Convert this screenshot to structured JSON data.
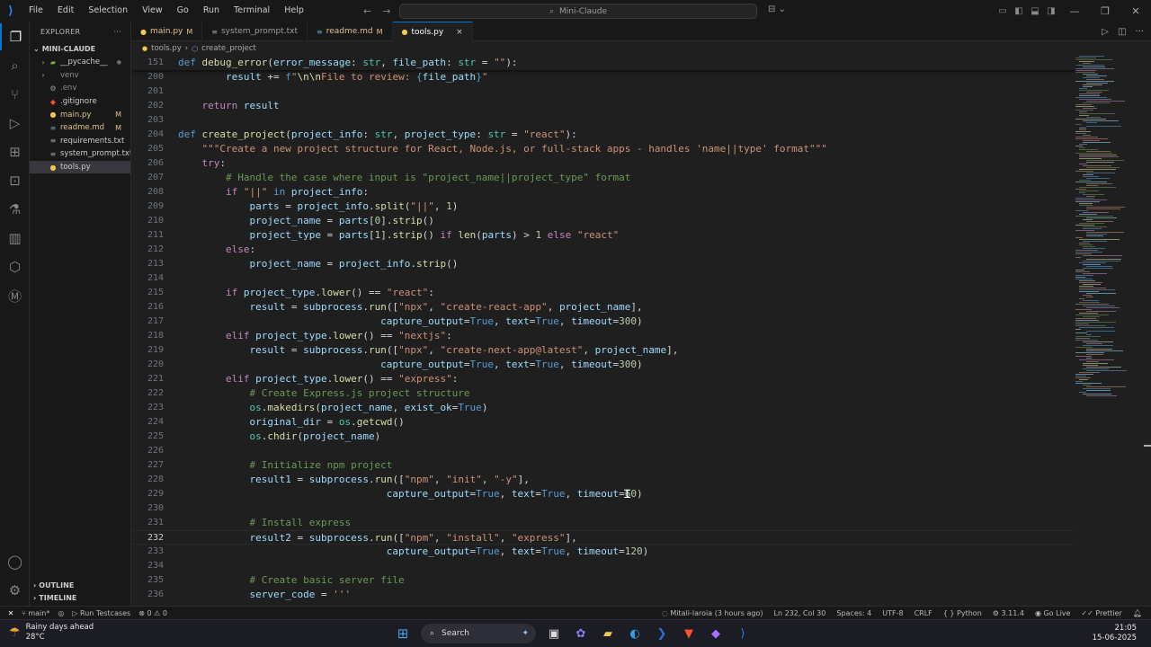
{
  "titlebar": {
    "menu": [
      "File",
      "Edit",
      "Selection",
      "View",
      "Go",
      "Run",
      "Terminal",
      "Help"
    ],
    "search_text": "Mini-Claude"
  },
  "explorer": {
    "header": "EXPLORER",
    "more": "···",
    "root": "MINI-CLAUDE",
    "items": [
      {
        "name": "__pycache__",
        "badge": "●",
        "type": "folder"
      },
      {
        "name": "venv",
        "badge": "",
        "type": "folder"
      },
      {
        "name": ".env",
        "badge": "",
        "type": "gear"
      },
      {
        "name": ".gitignore",
        "badge": "",
        "type": "git"
      },
      {
        "name": "main.py",
        "badge": "M",
        "type": "py"
      },
      {
        "name": "readme.md",
        "badge": "M",
        "type": "md"
      },
      {
        "name": "requirements.txt",
        "badge": "",
        "type": "txt"
      },
      {
        "name": "system_prompt.txt",
        "badge": "",
        "type": "txt"
      },
      {
        "name": "tools.py",
        "badge": "",
        "type": "py"
      }
    ],
    "outline": "OUTLINE",
    "timeline": "TIMELINE"
  },
  "tabs": [
    {
      "label": "main.py",
      "status": "M"
    },
    {
      "label": "system_prompt.txt",
      "status": ""
    },
    {
      "label": "readme.md",
      "status": "M"
    },
    {
      "label": "tools.py",
      "status": "×"
    }
  ],
  "breadcrumb": {
    "file": "tools.py",
    "sep": "›",
    "symbol": "create_project"
  },
  "editor": {
    "lines": [
      {
        "n": "151",
        "html": "<span class=\"k\">def</span> <span class=\"f\">debug_error</span><span class=\"o\">(</span><span class=\"p\">error_message</span><span class=\"o\">: </span><span class=\"t\">str</span><span class=\"o\">, </span><span class=\"p\">file_path</span><span class=\"o\">: </span><span class=\"t\">str</span><span class=\"o\"> = </span><span class=\"s\">\"\"</span><span class=\"o\">):</span>"
      },
      {
        "n": "200",
        "html": "        <span class=\"p\">result</span><span class=\"o\"> += </span><span class=\"k\">f</span><span class=\"s\">\"</span><span class=\"f\">\\n\\n</span><span class=\"s\">File to review: </span><span class=\"k\">{</span><span class=\"p\">file_path</span><span class=\"k\">}</span><span class=\"s\">\"</span>"
      },
      {
        "n": "201",
        "html": ""
      },
      {
        "n": "202",
        "html": "    <span class=\"kc\">return</span> <span class=\"p\">result</span>"
      },
      {
        "n": "203",
        "html": ""
      },
      {
        "n": "204",
        "html": "<span class=\"k\">def</span> <span class=\"f\">create_project</span><span class=\"o\">(</span><span class=\"p\">project_info</span><span class=\"o\">: </span><span class=\"t\">str</span><span class=\"o\">, </span><span class=\"p\">project_type</span><span class=\"o\">: </span><span class=\"t\">str</span><span class=\"o\"> = </span><span class=\"s\">\"react\"</span><span class=\"o\">):</span>"
      },
      {
        "n": "205",
        "html": "    <span class=\"s\">\"\"\"Create a new project structure for React, Node.js, or full-stack apps - handles 'name||type' format\"\"\"</span>"
      },
      {
        "n": "206",
        "html": "    <span class=\"kc\">try</span><span class=\"o\">:</span>"
      },
      {
        "n": "207",
        "html": "        <span class=\"c\"># Handle the case where input is \"project_name||project_type\" format</span>"
      },
      {
        "n": "208",
        "html": "        <span class=\"kc\">if</span> <span class=\"s\">\"||\"</span> <span class=\"k\">in</span> <span class=\"p\">project_info</span><span class=\"o\">:</span>"
      },
      {
        "n": "209",
        "html": "            <span class=\"p\">parts</span><span class=\"o\"> = </span><span class=\"p\">project_info</span><span class=\"o\">.</span><span class=\"f\">split</span><span class=\"o\">(</span><span class=\"s\">\"||\"</span><span class=\"o\">, </span><span class=\"n\">1</span><span class=\"o\">)</span>"
      },
      {
        "n": "210",
        "html": "            <span class=\"p\">project_name</span><span class=\"o\"> = </span><span class=\"p\">parts</span><span class=\"o\">[</span><span class=\"n\">0</span><span class=\"o\">].</span><span class=\"f\">strip</span><span class=\"o\">()</span>"
      },
      {
        "n": "211",
        "html": "            <span class=\"p\">project_type</span><span class=\"o\"> = </span><span class=\"p\">parts</span><span class=\"o\">[</span><span class=\"n\">1</span><span class=\"o\">].</span><span class=\"f\">strip</span><span class=\"o\">() </span><span class=\"kc\">if</span> <span class=\"f\">len</span><span class=\"o\">(</span><span class=\"p\">parts</span><span class=\"o\">) &gt; </span><span class=\"n\">1</span> <span class=\"kc\">else</span> <span class=\"s\">\"react\"</span>"
      },
      {
        "n": "212",
        "html": "        <span class=\"kc\">else</span><span class=\"o\">:</span>"
      },
      {
        "n": "213",
        "html": "            <span class=\"p\">project_name</span><span class=\"o\"> = </span><span class=\"p\">project_info</span><span class=\"o\">.</span><span class=\"f\">strip</span><span class=\"o\">()</span>"
      },
      {
        "n": "214",
        "html": ""
      },
      {
        "n": "215",
        "html": "        <span class=\"kc\">if</span> <span class=\"p\">project_type</span><span class=\"o\">.</span><span class=\"f\">lower</span><span class=\"o\">() == </span><span class=\"s\">\"react\"</span><span class=\"o\">:</span>"
      },
      {
        "n": "216",
        "html": "            <span class=\"p\">result</span><span class=\"o\"> = </span><span class=\"p\">subprocess</span><span class=\"o\">.</span><span class=\"f\">run</span><span class=\"o\">([</span><span class=\"s\">\"npx\"</span><span class=\"o\">, </span><span class=\"s\">\"create-react-app\"</span><span class=\"o\">, </span><span class=\"p\">project_name</span><span class=\"o\">],</span>"
      },
      {
        "n": "217",
        "html": "                                  <span class=\"p\">capture_output</span><span class=\"o\">=</span><span class=\"k\">True</span><span class=\"o\">, </span><span class=\"p\">text</span><span class=\"o\">=</span><span class=\"k\">True</span><span class=\"o\">, </span><span class=\"p\">timeout</span><span class=\"o\">=</span><span class=\"n\">300</span><span class=\"o\">)</span>"
      },
      {
        "n": "218",
        "html": "        <span class=\"kc\">elif</span> <span class=\"p\">project_type</span><span class=\"o\">.</span><span class=\"f\">lower</span><span class=\"o\">() == </span><span class=\"s\">\"nextjs\"</span><span class=\"o\">:</span>"
      },
      {
        "n": "219",
        "html": "            <span class=\"p\">result</span><span class=\"o\"> = </span><span class=\"p\">subprocess</span><span class=\"o\">.</span><span class=\"f\">run</span><span class=\"o\">([</span><span class=\"s\">\"npx\"</span><span class=\"o\">, </span><span class=\"s\">\"create-next-app@latest\"</span><span class=\"o\">, </span><span class=\"p\">project_name</span><span class=\"o\">],</span>"
      },
      {
        "n": "220",
        "html": "                                  <span class=\"p\">capture_output</span><span class=\"o\">=</span><span class=\"k\">True</span><span class=\"o\">, </span><span class=\"p\">text</span><span class=\"o\">=</span><span class=\"k\">True</span><span class=\"o\">, </span><span class=\"p\">timeout</span><span class=\"o\">=</span><span class=\"n\">300</span><span class=\"o\">)</span>"
      },
      {
        "n": "221",
        "html": "        <span class=\"kc\">elif</span> <span class=\"p\">project_type</span><span class=\"o\">.</span><span class=\"f\">lower</span><span class=\"o\">() == </span><span class=\"s\">\"express\"</span><span class=\"o\">:</span>"
      },
      {
        "n": "222",
        "html": "            <span class=\"c\"># Create Express.js project structure</span>"
      },
      {
        "n": "223",
        "html": "            <span class=\"t\">os</span><span class=\"o\">.</span><span class=\"f\">makedirs</span><span class=\"o\">(</span><span class=\"p\">project_name</span><span class=\"o\">, </span><span class=\"p\">exist_ok</span><span class=\"o\">=</span><span class=\"k\">True</span><span class=\"o\">)</span>"
      },
      {
        "n": "224",
        "html": "            <span class=\"p\">original_dir</span><span class=\"o\"> = </span><span class=\"t\">os</span><span class=\"o\">.</span><span class=\"f\">getcwd</span><span class=\"o\">()</span>"
      },
      {
        "n": "225",
        "html": "            <span class=\"t\">os</span><span class=\"o\">.</span><span class=\"f\">chdir</span><span class=\"o\">(</span><span class=\"p\">project_name</span><span class=\"o\">)</span>"
      },
      {
        "n": "226",
        "html": ""
      },
      {
        "n": "227",
        "html": "            <span class=\"c\"># Initialize npm project</span>"
      },
      {
        "n": "228",
        "html": "            <span class=\"p\">result1</span><span class=\"o\"> = </span><span class=\"p\">subprocess</span><span class=\"o\">.</span><span class=\"f\">run</span><span class=\"o\">([</span><span class=\"s\">\"npm\"</span><span class=\"o\">, </span><span class=\"s\">\"init\"</span><span class=\"o\">, </span><span class=\"s\">\"-y\"</span><span class=\"o\">],</span>"
      },
      {
        "n": "229",
        "html": "                                   <span class=\"p\">capture_output</span><span class=\"o\">=</span><span class=\"k\">True</span><span class=\"o\">, </span><span class=\"p\">text</span><span class=\"o\">=</span><span class=\"k\">True</span><span class=\"o\">, </span><span class=\"p\">timeout</span><span class=\"o\">=</span><span class=\"n\">60</span><span class=\"o\">)</span>"
      },
      {
        "n": "230",
        "html": ""
      },
      {
        "n": "231",
        "html": "            <span class=\"c\"># Install express</span>"
      },
      {
        "n": "232",
        "html": "            <span class=\"p\">result2</span><span class=\"o\"> = </span><span class=\"p\">subprocess</span><span class=\"o\">.</span><span class=\"f\">run</span><span class=\"o\">([</span><span class=\"s\">\"npm\"</span><span class=\"o\">, </span><span class=\"s\">\"install\"</span><span class=\"o\">, </span><span class=\"s\">\"express\"</span><span class=\"o\">],</span>"
      },
      {
        "n": "233",
        "html": "                                   <span class=\"p\">capture_output</span><span class=\"o\">=</span><span class=\"k\">True</span><span class=\"o\">, </span><span class=\"p\">text</span><span class=\"o\">=</span><span class=\"k\">True</span><span class=\"o\">, </span><span class=\"p\">timeout</span><span class=\"o\">=</span><span class=\"n\">120</span><span class=\"o\">)</span>"
      },
      {
        "n": "234",
        "html": ""
      },
      {
        "n": "235",
        "html": "            <span class=\"c\"># Create basic server file</span>"
      },
      {
        "n": "236",
        "html": "            <span class=\"p\">server_code</span><span class=\"o\"> = </span><span class=\"s\">'''</span>"
      }
    ],
    "current_line": "232"
  },
  "statusbar": {
    "branch": "main*",
    "run_testcases": "Run Testcases",
    "problems": "⊗ 0  ⚠ 0",
    "blame": "Mitali-laroia (3 hours ago)",
    "position": "Ln 232, Col 30",
    "spaces": "Spaces: 4",
    "encoding": "UTF-8",
    "eol": "CRLF",
    "language": "Python",
    "python_version": "3.11.4",
    "golive": "Go Live",
    "prettier": "Prettier"
  },
  "taskbar": {
    "weather_title": "Rainy days ahead",
    "weather_temp": "28°C",
    "search": "Search",
    "time": "21:05",
    "date": "15-06-2025"
  },
  "colors": {
    "accent": "#0078d4",
    "modified": "#e2c08d",
    "editor_bg": "#1f1f1f"
  }
}
